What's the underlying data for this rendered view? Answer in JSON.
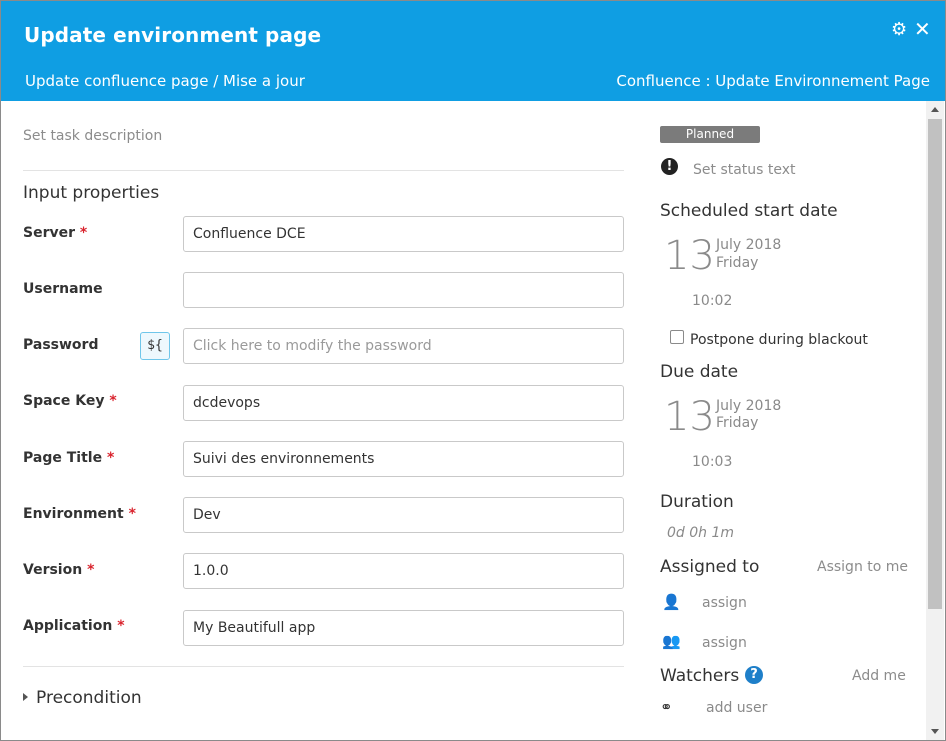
{
  "header": {
    "title": "Update environment page",
    "breadcrumb": "Update confluence page / Mise a jour",
    "right_crumb": "Confluence : Update Environnement Page",
    "icons": [
      "gear-icon",
      "close-icon"
    ],
    "bg_color": "#0f9ee3"
  },
  "left": {
    "description_placeholder": "Set task description",
    "input_properties_title": "Input properties",
    "fields": [
      {
        "label": "Server",
        "required": "*",
        "value": "Confluence DCE"
      },
      {
        "label": "Username",
        "required": "",
        "value": ""
      },
      {
        "label": "Password",
        "required": "",
        "value": "",
        "placeholder": "Click here to modify the password",
        "var_button": "${"
      },
      {
        "label": "Space Key",
        "required": "*",
        "value": "dcdevops"
      },
      {
        "label": "Page Title",
        "required": "*",
        "value": "Suivi des environnements"
      },
      {
        "label": "Environment",
        "required": "*",
        "value": "Dev"
      },
      {
        "label": "Version",
        "required": "*",
        "value": "1.0.0"
      },
      {
        "label": "Application",
        "required": "*",
        "value": "My Beautifull app"
      }
    ],
    "precondition": "Precondition"
  },
  "right": {
    "status_badge": "Planned",
    "status_text": "Set status text",
    "scheduled_title": "Scheduled start date",
    "scheduled": {
      "day": "13",
      "month_year": "July 2018",
      "weekday": "Friday",
      "time": "10:02"
    },
    "postpone_label": "Postpone during blackout",
    "due_title": "Due date",
    "due": {
      "day": "13",
      "month_year": "July 2018",
      "weekday": "Friday",
      "time": "10:03"
    },
    "duration_title": "Duration",
    "duration_value": "0d 0h 1m",
    "assigned_title": "Assigned to",
    "assign_to_me": "Assign to me",
    "assign_user": "assign",
    "assign_team": "assign",
    "watchers_title": "Watchers",
    "add_me": "Add me",
    "add_user": "add user"
  }
}
